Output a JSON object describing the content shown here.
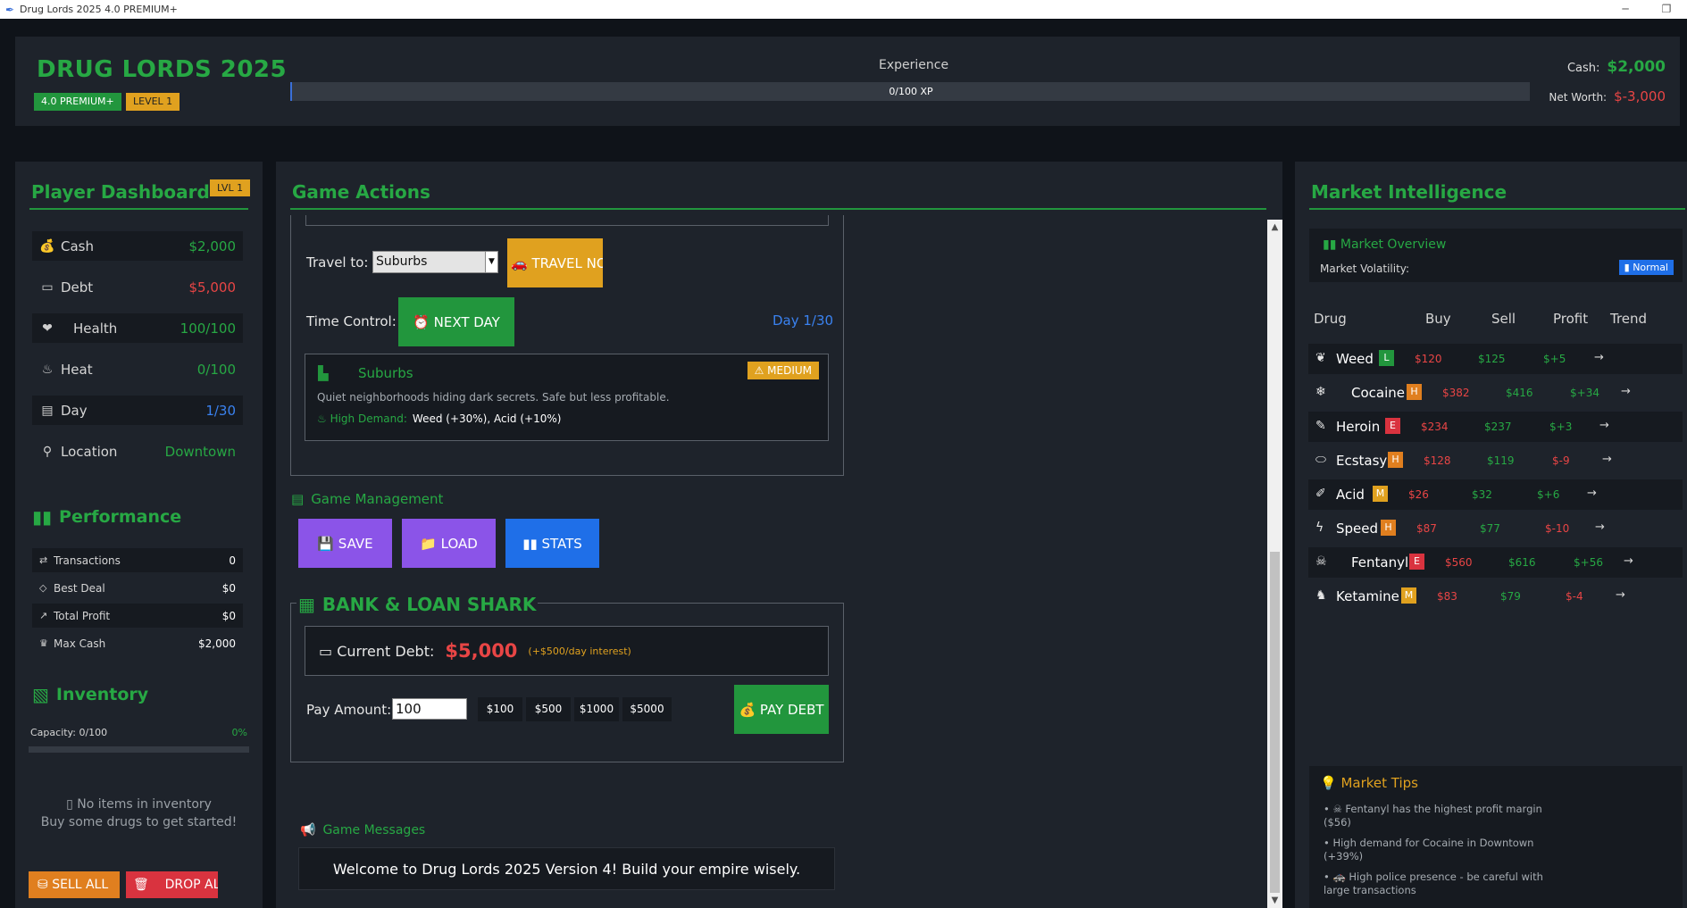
{
  "window": {
    "title": "Drug Lords 2025 4.0 PREMIUM+",
    "minimize_glyph": "─",
    "restore_glyph": "❐"
  },
  "header": {
    "title": "DRUG LORDS 2025",
    "edition_badge": "4.0 PREMIUM+",
    "level_badge": "LEVEL 1",
    "xp_label": "Experience",
    "xp_text": "0/100 XP",
    "xp_progress": 0,
    "cash_label": "Cash:",
    "cash_value": "$2,000",
    "net_worth_label": "Net Worth:",
    "net_worth_value": "$-3,000"
  },
  "player": {
    "title": "Player Dashboard",
    "level_badge": "LVL 1",
    "stats": [
      {
        "icon": "money-bag-icon",
        "label": "Cash",
        "value": "$2,000",
        "color": "#27a844"
      },
      {
        "icon": "credit-card-icon",
        "label": "Debt",
        "value": "$5,000",
        "color": "#e84545"
      },
      {
        "icon": "heart-icon",
        "label": "Health",
        "value": "100/100",
        "color": "#27a844"
      },
      {
        "icon": "flame-icon",
        "label": "Heat",
        "value": "0/100",
        "color": "#27a844"
      },
      {
        "icon": "calendar-icon",
        "label": "Day",
        "value": "1/30",
        "color": "#3a82f0"
      },
      {
        "icon": "map-pin-icon",
        "label": "Location",
        "value": "Downtown",
        "color": "#27a844"
      }
    ],
    "performance": {
      "title": "Performance",
      "rows": [
        {
          "icon": "exchange-icon",
          "label": "Transactions",
          "value": "0"
        },
        {
          "icon": "gem-icon",
          "label": "Best Deal",
          "value": "$0"
        },
        {
          "icon": "chart-up-icon",
          "label": "Total Profit",
          "value": "$0"
        },
        {
          "icon": "trophy-icon",
          "label": "Max Cash",
          "value": "$2,000"
        }
      ]
    },
    "inventory": {
      "title": "Inventory",
      "capacity_label": "Capacity: 0/100",
      "capacity_pct": "0%",
      "capacity_fill": 0,
      "empty_line1": "No items in inventory",
      "empty_line2": "Buy some drugs to get started!",
      "sell_all": "SELL ALL",
      "drop_all": "DROP ALL"
    }
  },
  "actions": {
    "title": "Game Actions",
    "travel_label": "Travel to:",
    "travel_selected": "Suburbs",
    "travel_button": "TRAVEL NOW",
    "time_label": "Time Control:",
    "next_day_button": "NEXT DAY",
    "day_label": "Day 1/30",
    "location_card": {
      "name": "Suburbs",
      "risk": "MEDIUM",
      "description": "Quiet neighborhoods hiding dark secrets. Safe but less profitable.",
      "demand_label": "High Demand:",
      "demand_value": "Weed (+30%), Acid (+10%)"
    },
    "management": {
      "title": "Game Management",
      "save": "SAVE",
      "load": "LOAD",
      "stats": "STATS"
    },
    "bank": {
      "title": "BANK & LOAN SHARK",
      "debt_label": "Current Debt:",
      "debt_value": "$5,000",
      "interest": "(+$500/day interest)",
      "pay_label": "Pay Amount:",
      "pay_value": "100",
      "quick": [
        "$100",
        "$500",
        "$1000",
        "$5000"
      ],
      "pay_button": "PAY DEBT"
    },
    "messages": {
      "title": "Game Messages",
      "text": "Welcome to Drug Lords 2025 Version 4! Build your empire wisely."
    }
  },
  "market": {
    "title": "Market Intelligence",
    "overview_title": "Market Overview",
    "volatility_label": "Market Volatility:",
    "volatility_value": "Normal",
    "headers": {
      "drug": "Drug",
      "buy": "Buy",
      "sell": "Sell",
      "profit": "Profit",
      "trend": "Trend"
    },
    "rows": [
      {
        "icon": "leaf-icon",
        "name": "Weed",
        "tier": "L",
        "buy": "$120",
        "sell": "$125",
        "profit": "$+5",
        "trend": "→"
      },
      {
        "icon": "snowflake-icon",
        "name": "Cocaine",
        "tier": "H",
        "buy": "$382",
        "sell": "$416",
        "profit": "$+34",
        "trend": "→"
      },
      {
        "icon": "syringe-icon",
        "name": "Heroin",
        "tier": "E",
        "buy": "$234",
        "sell": "$237",
        "profit": "$+3",
        "trend": "→"
      },
      {
        "icon": "pill-icon",
        "name": "Ecstasy",
        "tier": "H",
        "buy": "$128",
        "sell": "$119",
        "profit": "$-9",
        "trend": "→"
      },
      {
        "icon": "dropper-icon",
        "name": "Acid",
        "tier": "M",
        "buy": "$26",
        "sell": "$32",
        "profit": "$+6",
        "trend": "→"
      },
      {
        "icon": "lightning-icon",
        "name": "Speed",
        "tier": "H",
        "buy": "$87",
        "sell": "$77",
        "profit": "$-10",
        "trend": "→"
      },
      {
        "icon": "skull-icon",
        "name": "Fentanyl",
        "tier": "E",
        "buy": "$560",
        "sell": "$616",
        "profit": "$+56",
        "trend": "→"
      },
      {
        "icon": "horse-icon",
        "name": "Ketamine",
        "tier": "M",
        "buy": "$83",
        "sell": "$79",
        "profit": "$-4",
        "trend": "→"
      }
    ],
    "tips_title": "Market Tips",
    "tips": [
      "• ☠ Fentanyl has the highest profit margin ($56)",
      "• High demand for Cocaine in Downtown (+39%)",
      "• 🚓 High police presence - be careful with large transactions"
    ]
  }
}
